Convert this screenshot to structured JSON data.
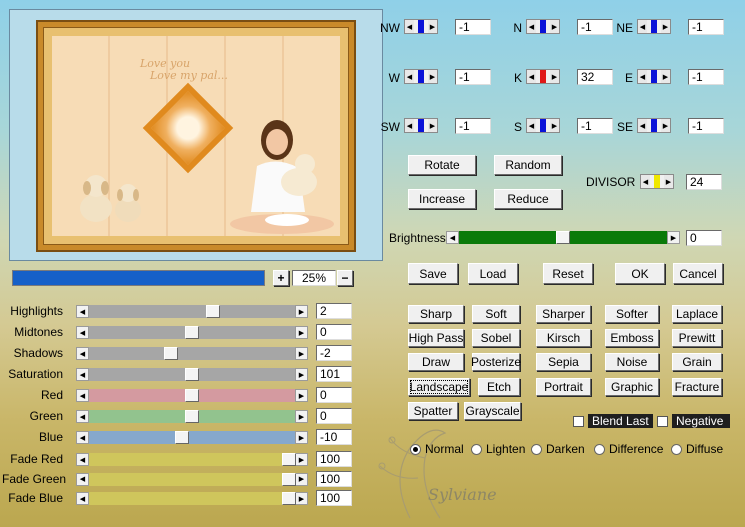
{
  "preview": {
    "watermark_line1": "Love you",
    "watermark_line2": "Love my pal..."
  },
  "zoom": {
    "value": "25%",
    "progress": 1.0,
    "plus": "+",
    "minus": "−"
  },
  "directions": [
    {
      "key": "nw",
      "label": "NW",
      "value": "-1",
      "color": "#0a12d8"
    },
    {
      "key": "n",
      "label": "N",
      "value": "-1",
      "color": "#0a12d8"
    },
    {
      "key": "ne",
      "label": "NE",
      "value": "-1",
      "color": "#0a12d8"
    },
    {
      "key": "w",
      "label": "W",
      "value": "-1",
      "color": "#0a12d8"
    },
    {
      "key": "k",
      "label": "K",
      "value": "32",
      "color": "#e01818"
    },
    {
      "key": "e",
      "label": "E",
      "value": "-1",
      "color": "#0a12d8"
    },
    {
      "key": "sw",
      "label": "SW",
      "value": "-1",
      "color": "#0a12d8"
    },
    {
      "key": "s",
      "label": "S",
      "value": "-1",
      "color": "#0a12d8"
    },
    {
      "key": "se",
      "label": "SE",
      "value": "-1",
      "color": "#0a12d8"
    }
  ],
  "buttons": {
    "rotate": "Rotate",
    "random": "Random",
    "increase": "Increase",
    "reduce": "Reduce",
    "save": "Save",
    "load": "Load",
    "reset": "Reset",
    "ok": "OK",
    "cancel": "Cancel"
  },
  "divisor": {
    "label": "DIVISOR",
    "value": "24",
    "color": "#f0e800"
  },
  "brightness": {
    "label": "Brightness",
    "value": "0",
    "level": 0.5,
    "color": "#0a7a0a"
  },
  "filters": [
    [
      "Sharp",
      "Soft",
      "Sharper",
      "Softer",
      "Laplace"
    ],
    [
      "High Pass",
      "Sobel",
      "Kirsch",
      "Emboss",
      "Prewitt"
    ],
    [
      "Draw",
      "Posterize",
      "Sepia",
      "Noise",
      "Grain"
    ],
    [
      "Landscape",
      "Etch",
      "Portrait",
      "Graphic",
      "Fracture"
    ],
    [
      "Spatter",
      "Grayscale"
    ]
  ],
  "checks": {
    "blend_last": "Blend Last",
    "negative": "Negative"
  },
  "modes": {
    "selected": "Normal",
    "options": [
      "Normal",
      "Lighten",
      "Darken",
      "Difference",
      "Diffuse"
    ]
  },
  "signature": "Sylviane",
  "tones": [
    {
      "label": "Highlights",
      "value": "2",
      "level": 0.6,
      "track": "#a6a6a6"
    },
    {
      "label": "Midtones",
      "value": "0",
      "level": 0.5,
      "track": "#a6a6a6"
    },
    {
      "label": "Shadows",
      "value": "-2",
      "level": 0.4,
      "track": "#a6a6a6"
    },
    {
      "label": "Saturation",
      "value": "101",
      "level": 0.5,
      "track": "#a6a6a6"
    },
    {
      "label": "Red",
      "value": "0",
      "level": 0.5,
      "track": "#d49aa0"
    },
    {
      "label": "Green",
      "value": "0",
      "level": 0.5,
      "track": "#92c38e"
    },
    {
      "label": "Blue",
      "value": "-10",
      "level": 0.45,
      "track": "#86a8cc"
    },
    {
      "label": "Fade Red",
      "value": "100",
      "level": 0.97,
      "track": "#cfc65c"
    },
    {
      "label": "Fade Green",
      "value": "100",
      "level": 0.97,
      "track": "#cfc65c"
    },
    {
      "label": "Fade Blue",
      "value": "100",
      "level": 0.97,
      "track": "#cfc65c"
    }
  ]
}
